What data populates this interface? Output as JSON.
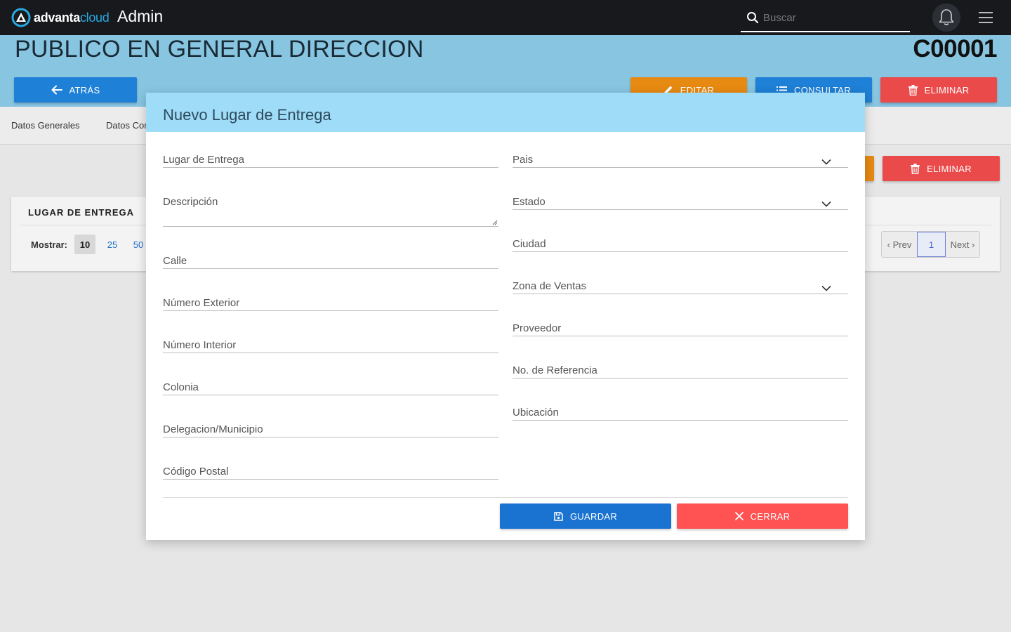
{
  "topbar": {
    "logo_brand": "advanta",
    "logo_suffix": "cloud",
    "app_title": "Admin",
    "search_placeholder": "Buscar"
  },
  "header": {
    "title": "PUBLICO EN GENERAL DIRECCION",
    "code": "C00001",
    "back_label": "ATRÁS",
    "edit_label": "EDITAR",
    "consult_label": "CONSULTAR",
    "delete_label": "ELIMINAR"
  },
  "tabs": [
    {
      "label": "Datos Generales"
    },
    {
      "label": "Datos Com"
    }
  ],
  "section": {
    "delete_label": "ELIMINAR",
    "card_title": "LUGAR DE ENTREGA",
    "show_label": "Mostrar:",
    "page_sizes": [
      "10",
      "25",
      "50"
    ],
    "pager": {
      "prev": "‹ Prev",
      "current": "1",
      "next": "Next ›"
    }
  },
  "modal": {
    "title": "Nuevo Lugar de Entrega",
    "left_fields": [
      {
        "label": "Lugar de Entrega"
      },
      {
        "label": "Descripción"
      },
      {
        "label": "Calle"
      },
      {
        "label": "Número Exterior"
      },
      {
        "label": "Número Interior"
      },
      {
        "label": "Colonia"
      },
      {
        "label": "Delegacion/Municipio"
      },
      {
        "label": "Código Postal"
      }
    ],
    "right_fields": [
      {
        "label": "Pais",
        "select": true
      },
      {
        "label": "Estado",
        "select": true
      },
      {
        "label": "Ciudad",
        "select": false
      },
      {
        "label": "Zona de Ventas",
        "select": true
      },
      {
        "label": "Proveedor",
        "select": false
      },
      {
        "label": "No. de Referencia",
        "select": false
      },
      {
        "label": "Ubicación",
        "select": false
      }
    ],
    "save_label": "GUARDAR",
    "close_label": "CERRAR"
  },
  "colors": {
    "topbar": "#17191c",
    "band": "#87c5e1",
    "modal_header": "#9fdcf7",
    "primary": "#1e80d6",
    "danger": "#ea4a4a",
    "close": "#ff5252",
    "warning": "#e78a12"
  }
}
